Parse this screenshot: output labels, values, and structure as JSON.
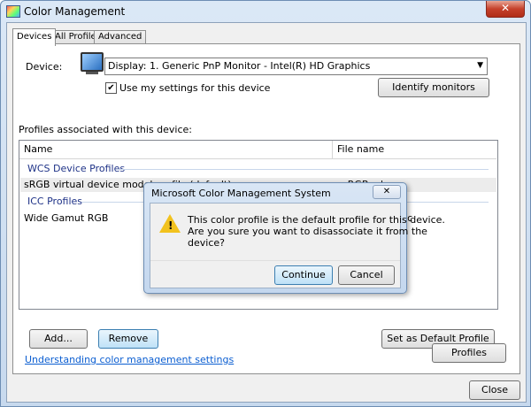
{
  "window": {
    "title": "Color Management",
    "close_glyph": "✕"
  },
  "tabs": [
    {
      "label": "Devices",
      "active": true
    },
    {
      "label": "All Profiles",
      "active": false
    },
    {
      "label": "Advanced",
      "active": false
    }
  ],
  "device": {
    "label": "Device:",
    "selected": "Display: 1. Generic PnP Monitor - Intel(R) HD Graphics",
    "use_my_settings_label": "Use my settings for this device",
    "use_my_settings_checked": true,
    "identify_button": "Identify monitors"
  },
  "profiles": {
    "section_label": "Profiles associated with this device:",
    "columns": [
      "Name",
      "File name"
    ],
    "groups": [
      {
        "name": "WCS Device Profiles",
        "rows": [
          {
            "name": "sRGB virtual device model profile (default)",
            "file": "wsRGB.cdmp",
            "selected": true
          }
        ]
      },
      {
        "name": "ICC Profiles",
        "rows": [
          {
            "name": "Wide Gamut RGB",
            "file": "",
            "selected": false
          }
        ]
      }
    ],
    "partial_file_text": "icc"
  },
  "buttons": {
    "add": "Add...",
    "remove": "Remove",
    "set_default": "Set as Default Profile",
    "profiles": "Profiles",
    "close": "Close"
  },
  "link": "Understanding color management settings",
  "dialog": {
    "title": "Microsoft Color Management System",
    "close_glyph": "✕",
    "message_lines": [
      "This color profile is the default profile for this device.",
      "Are you sure you want to disassociate it from the",
      "device?"
    ],
    "continue": "Continue",
    "cancel": "Cancel"
  },
  "icons": {
    "window": "color-management-icon",
    "monitor": "monitor-icon",
    "warning": "warning-icon"
  },
  "colors": {
    "link": "#0b5ed1",
    "group_header": "#1e3287",
    "close_button": "#c5412b",
    "warning": "#f2c21d"
  }
}
